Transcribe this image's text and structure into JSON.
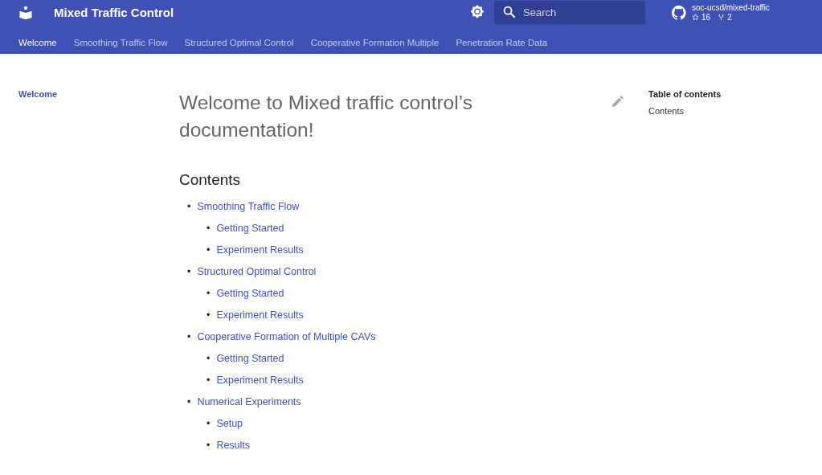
{
  "header": {
    "title": "Mixed Traffic Control",
    "search": {
      "placeholder": "Search"
    },
    "repo": {
      "name": "soc-ucsd/mixed-traffic",
      "stars": "16",
      "forks": "2"
    }
  },
  "tabs": [
    {
      "label": "Welcome",
      "selected": true
    },
    {
      "label": "Smoothing Traffic Flow",
      "selected": false
    },
    {
      "label": "Structured Optimal Control",
      "selected": false
    },
    {
      "label": "Cooperative Formation Multiple",
      "selected": false
    },
    {
      "label": "Penetration Rate Data",
      "selected": false
    }
  ],
  "sidebar": {
    "items": [
      {
        "label": "Welcome",
        "selected": true
      }
    ]
  },
  "article": {
    "title": "Welcome to Mixed traffic control’s documentation!",
    "heading": "Contents",
    "toc": [
      {
        "bullet": "•",
        "label": "Smoothing Traffic Flow",
        "children": [
          {
            "bullet": "•",
            "label": "Getting Started"
          },
          {
            "bullet": "•",
            "label": "Experiment Results"
          }
        ]
      },
      {
        "bullet": "•",
        "label": "Structured Optimal Control",
        "children": [
          {
            "bullet": "•",
            "label": "Getting Started"
          },
          {
            "bullet": "•",
            "label": "Experiment Results"
          }
        ]
      },
      {
        "bullet": "•",
        "label": "Cooperative Formation of Multiple CAVs",
        "children": [
          {
            "bullet": "•",
            "label": "Getting Started"
          },
          {
            "bullet": "•",
            "label": "Experiment Results"
          }
        ]
      },
      {
        "bullet": "•",
        "label": "Numerical Experiments",
        "children": [
          {
            "bullet": "•",
            "label": "Setup"
          },
          {
            "bullet": "•",
            "label": "Results"
          }
        ]
      }
    ]
  },
  "page_toc": {
    "title": "Table of contents",
    "items": [
      {
        "label": "Contents"
      }
    ]
  }
}
